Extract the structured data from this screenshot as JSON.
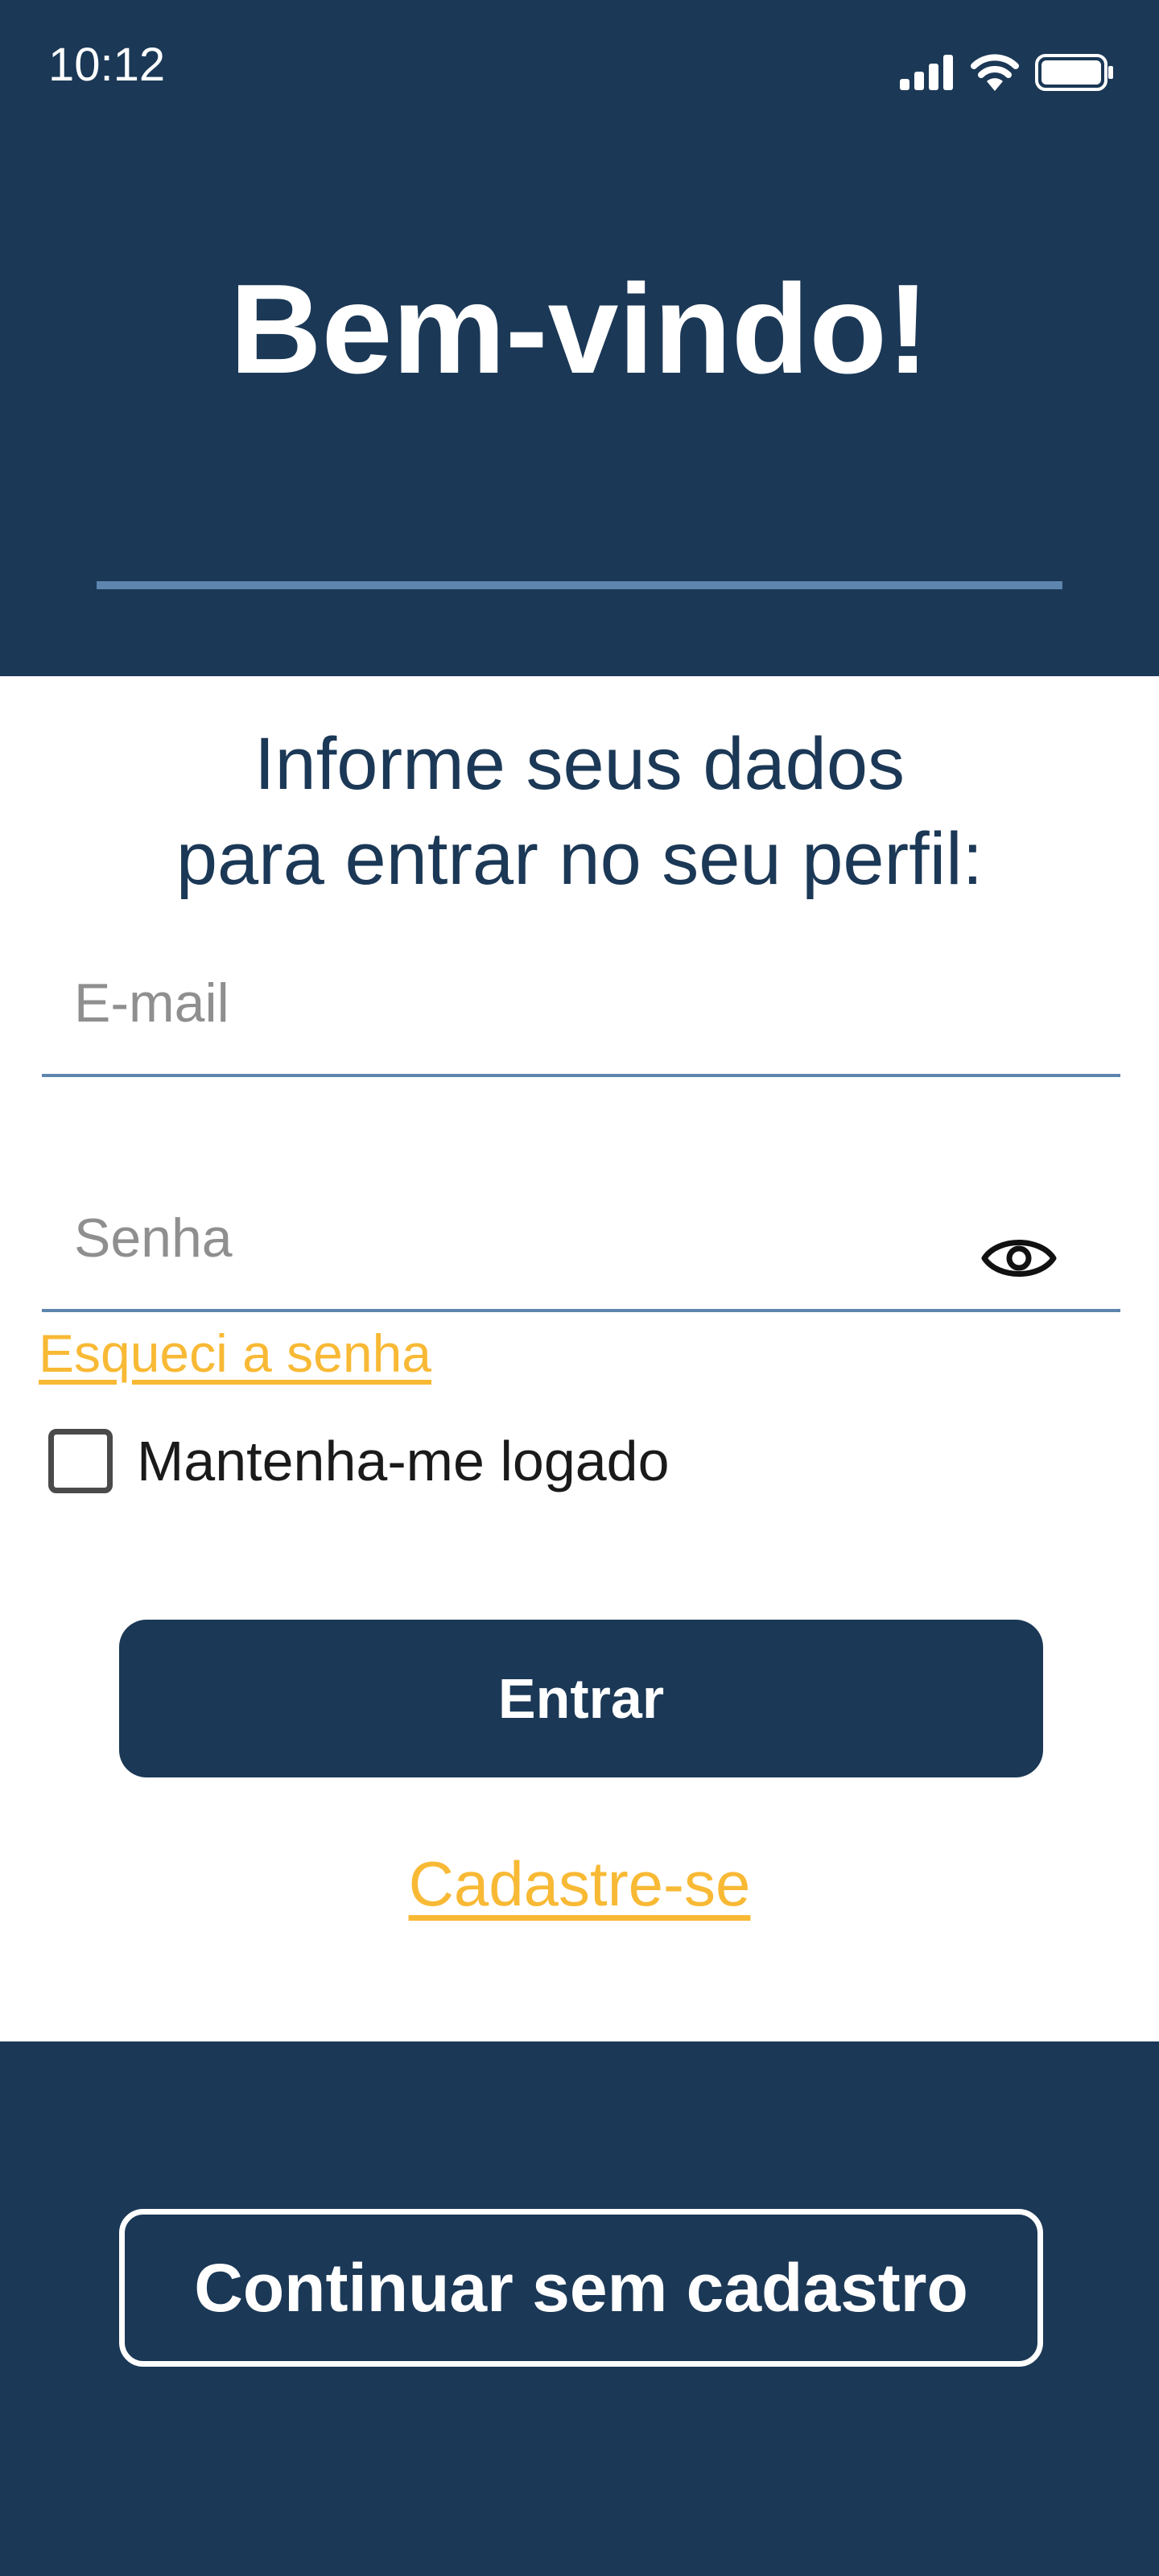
{
  "status_bar": {
    "time": "10:12",
    "icons": [
      "signal-icon",
      "wifi-icon",
      "battery-icon"
    ]
  },
  "header": {
    "title": "Bem-vindo!"
  },
  "login_form": {
    "heading_line1": "Informe seus dados",
    "heading_line2": "para entrar no seu perfil:",
    "email": {
      "value": "",
      "placeholder": "E-mail"
    },
    "password": {
      "value": "",
      "placeholder": "Senha",
      "toggle_icon": "eye-icon"
    },
    "forgot_password_label": "Esqueci a senha",
    "remember_me": {
      "label": "Mantenha-me logado",
      "checked": false
    },
    "submit_label": "Entrar",
    "signup_label": "Cadastre-se"
  },
  "guest_button_label": "Continuar sem cadastro",
  "colors": {
    "background": "#1b3856",
    "card": "#ffffff",
    "accent_link": "#f8b935",
    "divider": "#5d85ad",
    "primary_button": "#1b3856"
  }
}
